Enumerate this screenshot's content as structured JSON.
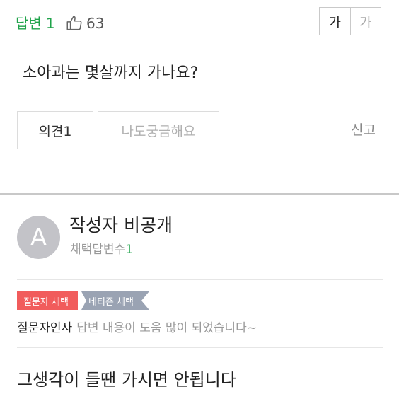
{
  "question": {
    "answer_label": "답변",
    "answer_count": "1",
    "like_count": "63",
    "font_size_toggle": {
      "large": "가",
      "small": "가"
    },
    "text": "소아과는 몇살까지 가나요?",
    "opinion_button": "의견1",
    "curious_button": "나도궁금해요",
    "report_link": "신고"
  },
  "answer": {
    "avatar_letter": "A",
    "author_name": "작성자 비공개",
    "adopted_label": "채택답변수",
    "adopted_count": "1",
    "badges": {
      "asker": "질문자 채택",
      "netizen": "네티즌 채택"
    },
    "thanks_label": "질문자인사",
    "thanks_text": "답변 내용이 도움 많이 되었습니다~",
    "body": "그생각이 들땐 가시면 안됩니다"
  },
  "colors": {
    "accent_green": "#1fa34a",
    "badge_red": "#f15c5c",
    "badge_gray": "#9aa3b3",
    "avatar": "#c3c3c8"
  },
  "icons": {
    "like": "thumbs-up-icon"
  }
}
